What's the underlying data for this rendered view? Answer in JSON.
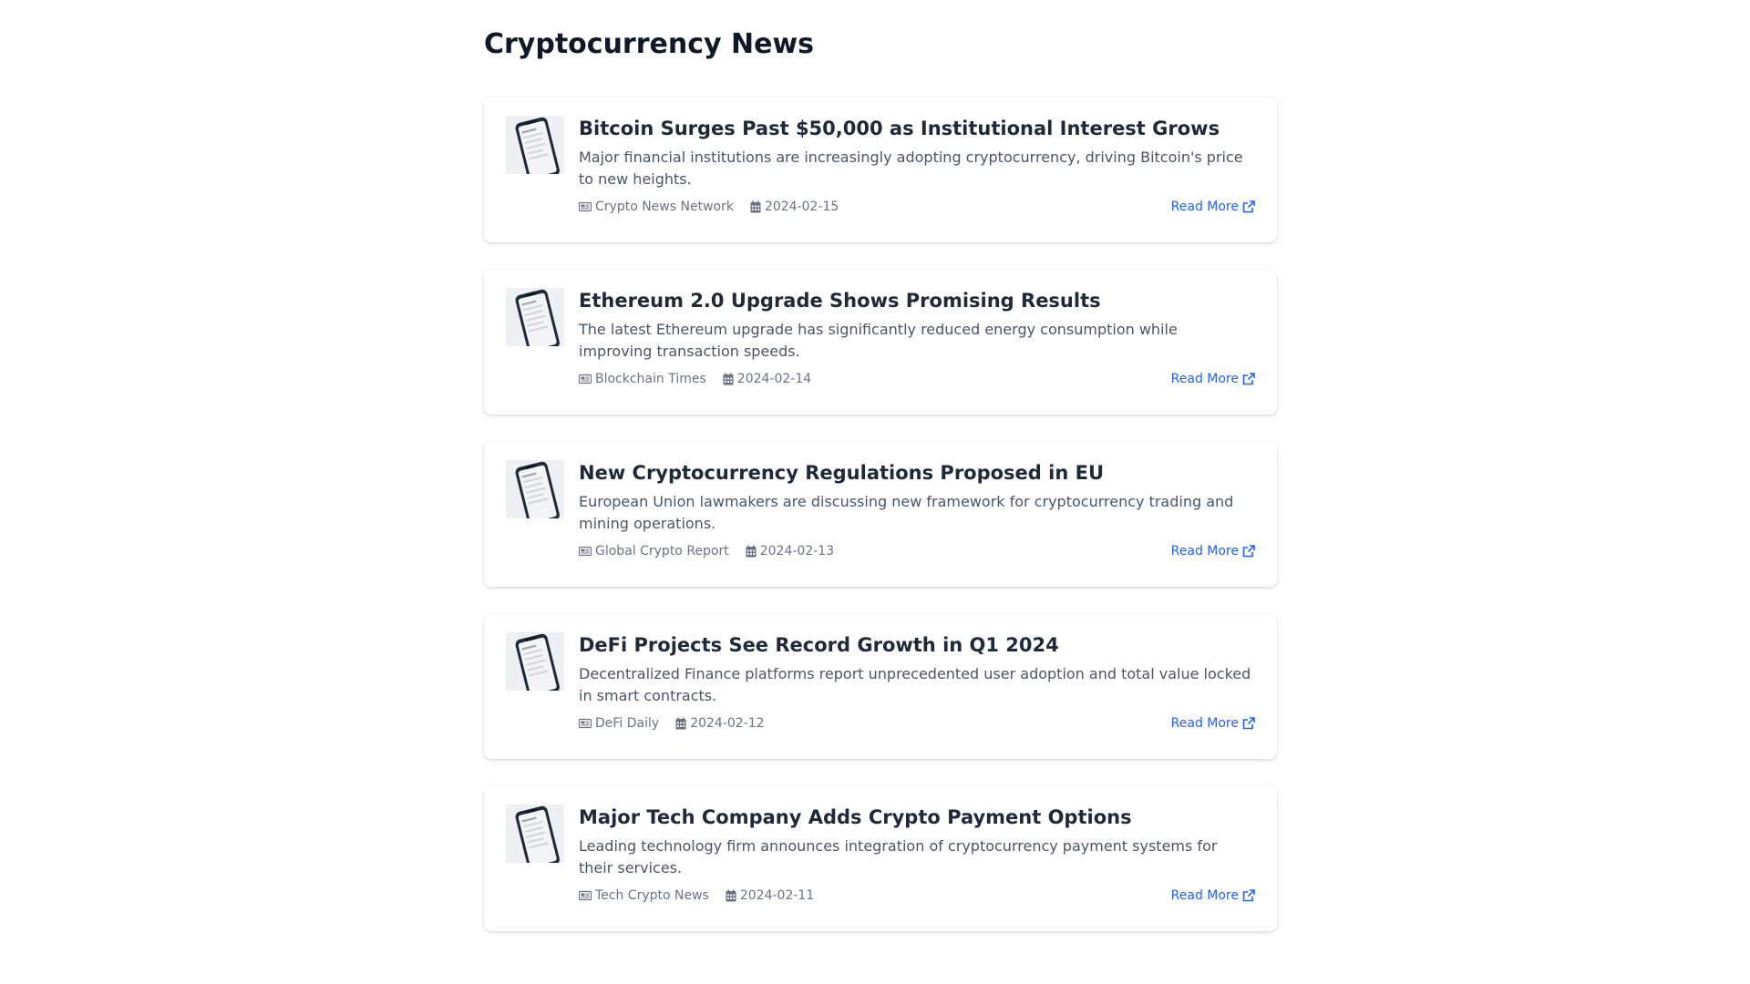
{
  "page": {
    "title": "Cryptocurrency News"
  },
  "theme": {
    "title_color": "#111827",
    "link_color": "#2563eb",
    "meta_color": "#6b7280"
  },
  "icons": {
    "source": "newspaper-icon",
    "date": "calendar-icon",
    "link": "external-link-icon",
    "thumbnail": "phone-app-thumbnail"
  },
  "articles": [
    {
      "title": "Bitcoin Surges Past $50,000 as Institutional Interest Grows",
      "summary": "Major financial institutions are increasingly adopting cryptocurrency, driving Bitcoin's price to new heights.",
      "source": "Crypto News Network",
      "date": "2024-02-15",
      "link_label": "Read More"
    },
    {
      "title": "Ethereum 2.0 Upgrade Shows Promising Results",
      "summary": "The latest Ethereum upgrade has significantly reduced energy consumption while improving transaction speeds.",
      "source": "Blockchain Times",
      "date": "2024-02-14",
      "link_label": "Read More"
    },
    {
      "title": "New Cryptocurrency Regulations Proposed in EU",
      "summary": "European Union lawmakers are discussing new framework for cryptocurrency trading and mining operations.",
      "source": "Global Crypto Report",
      "date": "2024-02-13",
      "link_label": "Read More"
    },
    {
      "title": "DeFi Projects See Record Growth in Q1 2024",
      "summary": "Decentralized Finance platforms report unprecedented user adoption and total value locked in smart contracts.",
      "source": "DeFi Daily",
      "date": "2024-02-12",
      "link_label": "Read More"
    },
    {
      "title": "Major Tech Company Adds Crypto Payment Options",
      "summary": "Leading technology firm announces integration of cryptocurrency payment systems for their services.",
      "source": "Tech Crypto News",
      "date": "2024-02-11",
      "link_label": "Read More"
    }
  ]
}
